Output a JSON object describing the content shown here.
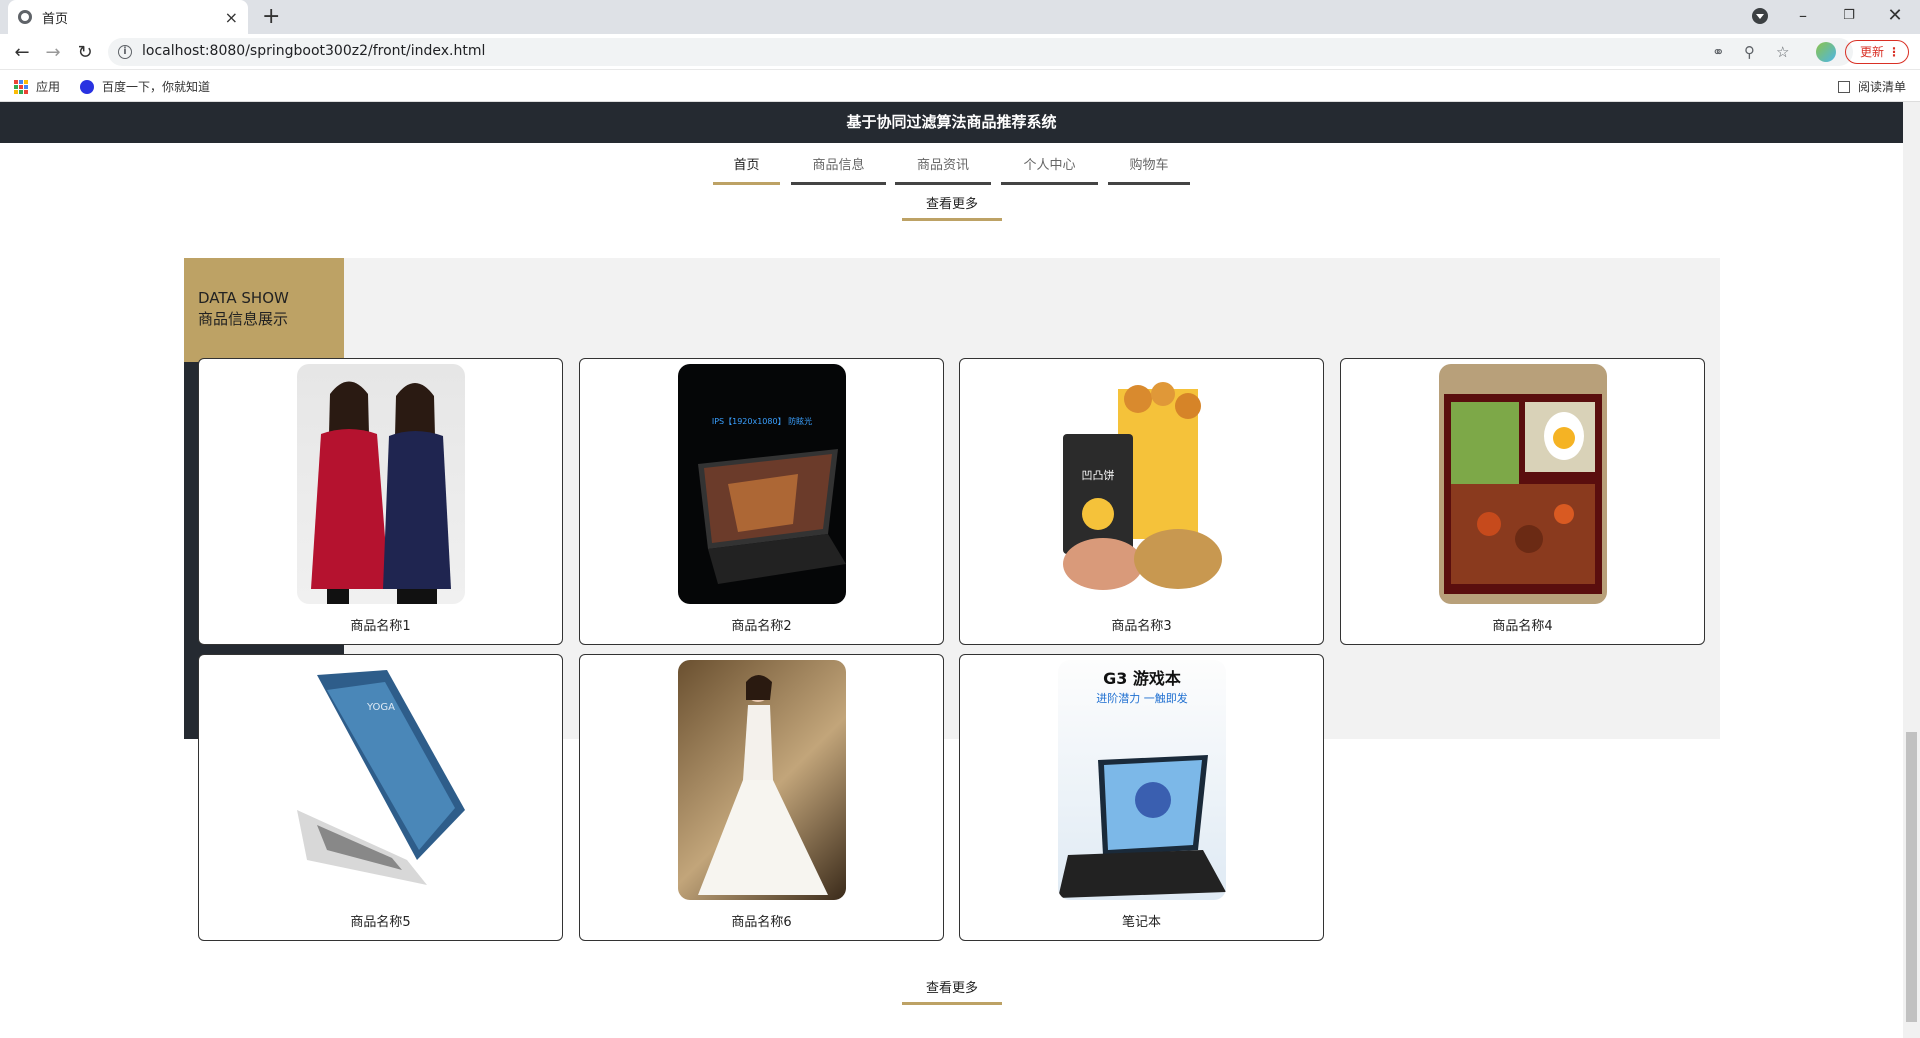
{
  "browser": {
    "tab_title": "首页",
    "tab_close": "×",
    "new_tab": "+",
    "url": "localhost:8080/springboot300z2/front/index.html",
    "update_label": "更新",
    "bookmarks": [
      "应用",
      "百度一下，你就知道"
    ],
    "reading_list": "阅读清单"
  },
  "site": {
    "title": "基于协同过滤算法商品推荐系统",
    "menu": [
      {
        "label": "首页",
        "active": true
      },
      {
        "label": "商品信息",
        "active": false
      },
      {
        "label": "商品资讯",
        "active": false
      },
      {
        "label": "个人中心",
        "active": false
      },
      {
        "label": "购物车",
        "active": false
      }
    ],
    "view_more": "查看更多"
  },
  "section": {
    "title_en": "DATA SHOW",
    "title_cn": "商品信息展示"
  },
  "products": [
    {
      "name": "商品名称1",
      "image": "two-women-dresses"
    },
    {
      "name": "商品名称2",
      "image": "gaming-laptop-dark",
      "image_text": "IPS【1920x1080】 防眩光"
    },
    {
      "name": "商品名称3",
      "image": "snack-packages",
      "image_text": "凹凸饼"
    },
    {
      "name": "商品名称4",
      "image": "food-bento-box"
    },
    {
      "name": "商品名称5",
      "image": "silver-laptop-yoga",
      "image_text": "YOGA"
    },
    {
      "name": "商品名称6",
      "image": "wedding-dress"
    },
    {
      "name": "笔记本",
      "image": "g3-gaming-laptop",
      "image_text": "G3 游戏本",
      "image_subtext": "进阶潜力 一触即发"
    }
  ],
  "colors": {
    "accent": "#bda265",
    "dark": "#252a31",
    "section_bg": "#f2f2f2"
  }
}
